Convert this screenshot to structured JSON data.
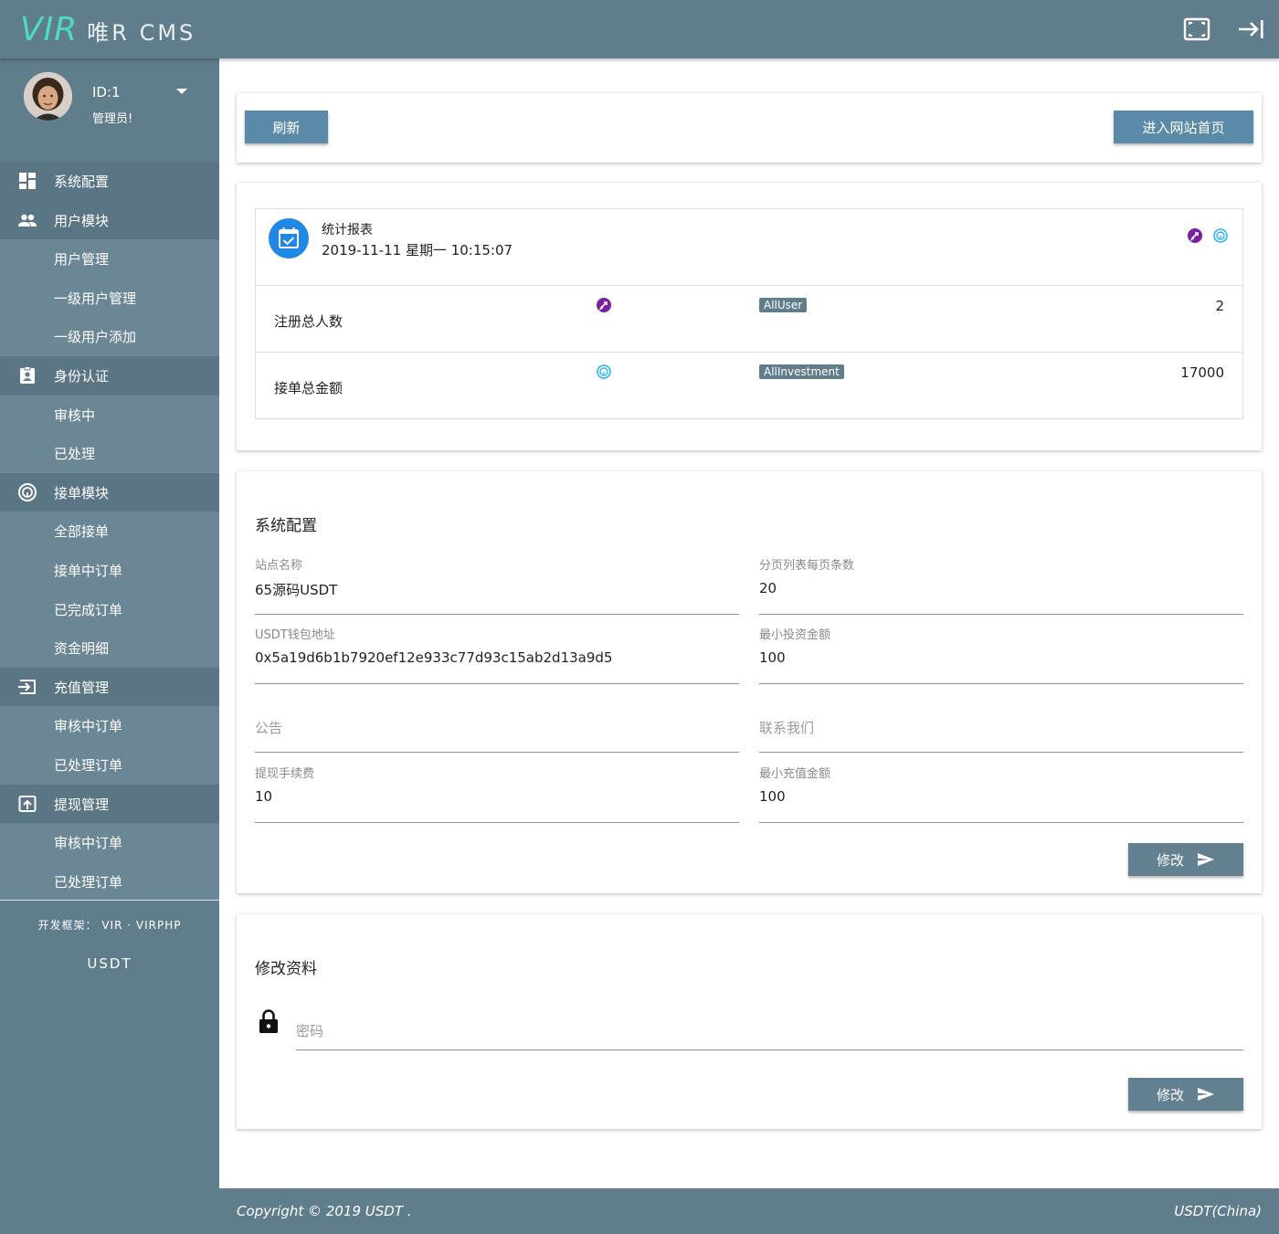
{
  "header": {
    "logo_main": "VIR",
    "logo_sub": "唯R CMS",
    "fullscreen_icon": "fullscreen-icon",
    "logout_icon": "logout-arrow-icon"
  },
  "profile": {
    "id_label": "ID:1",
    "role_label": "管理员!"
  },
  "sidebar": {
    "items": [
      {
        "label": "系统配置",
        "type": "group",
        "icon": "dashboard-icon"
      },
      {
        "label": "用户模块",
        "type": "group",
        "icon": "people-icon"
      },
      {
        "label": "用户管理",
        "type": "sub"
      },
      {
        "label": "一级用户管理",
        "type": "sub"
      },
      {
        "label": "一级用户添加",
        "type": "sub"
      },
      {
        "label": "身份认证",
        "type": "group",
        "icon": "badge-icon"
      },
      {
        "label": "审核中",
        "type": "sub"
      },
      {
        "label": "已处理",
        "type": "sub"
      },
      {
        "label": "接单模块",
        "type": "group",
        "icon": "fingerprint-icon"
      },
      {
        "label": "全部接单",
        "type": "sub"
      },
      {
        "label": "接单中订单",
        "type": "sub"
      },
      {
        "label": "已完成订单",
        "type": "sub"
      },
      {
        "label": "资金明细",
        "type": "sub"
      },
      {
        "label": "充值管理",
        "type": "group",
        "icon": "login-icon"
      },
      {
        "label": "审核中订单",
        "type": "sub"
      },
      {
        "label": "已处理订单",
        "type": "sub"
      },
      {
        "label": "提现管理",
        "type": "group",
        "icon": "upload-box-icon"
      },
      {
        "label": "审核中订单",
        "type": "sub"
      },
      {
        "label": "已处理订单",
        "type": "sub"
      }
    ],
    "framework_text": "开发框架： VIR · VIRPHP",
    "brand_text": "USDT"
  },
  "toolbar": {
    "refresh_label": "刷新",
    "home_label": "进入网站首页"
  },
  "stats": {
    "title": "统计报表",
    "datetime": "2019-11-11  星期一 10:15:07",
    "rows": [
      {
        "label": "注册总人数",
        "tag": "AllUser",
        "value": "2"
      },
      {
        "label": "接单总金额",
        "tag": "AllInvestment",
        "value": "17000"
      }
    ]
  },
  "config": {
    "title": "系统配置",
    "site_name_label": "站点名称",
    "site_name_value": "65源码USDT",
    "page_size_label": "分页列表每页条数",
    "page_size_value": "20",
    "wallet_label": "USDT钱包地址",
    "wallet_value": "0x5a19d6b1b7920ef12e933c77d93c15ab2d13a9d5",
    "min_invest_label": "最小投资金额",
    "min_invest_value": "100",
    "notice_placeholder": "公告",
    "contact_placeholder": "联系我们",
    "fee_label": "提现手续费",
    "fee_value": "10",
    "min_recharge_label": "最小充值金额",
    "min_recharge_value": "100",
    "submit_label": "修改"
  },
  "profile_edit": {
    "title": "修改资料",
    "password_placeholder": "密码",
    "submit_label": "修改"
  },
  "footer": {
    "copyright": "Copyright © 2019 USDT .",
    "region": "USDT(China)"
  },
  "colors": {
    "primary": "#607d8b",
    "button": "#5a8aa7",
    "accent": "#1e88e5",
    "logo": "#4fd8c4"
  }
}
